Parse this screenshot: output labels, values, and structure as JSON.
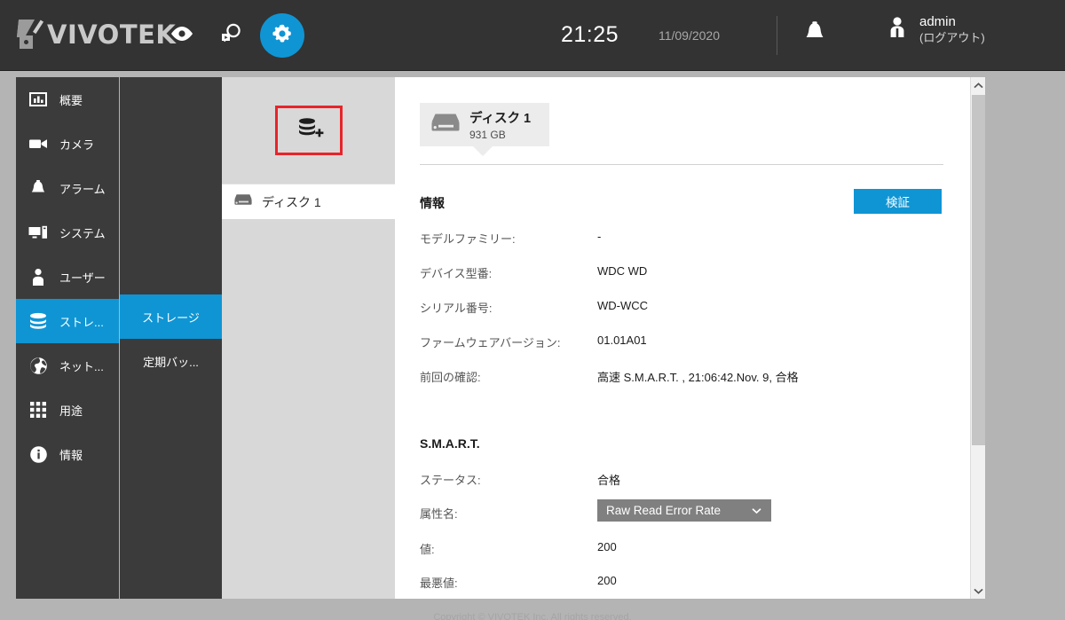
{
  "header": {
    "brand": "VIVOTEK",
    "nav": [
      {
        "name": "live-view",
        "icon": "eye-icon",
        "active": false
      },
      {
        "name": "playback-search",
        "icon": "search-playback-icon",
        "active": false
      },
      {
        "name": "settings",
        "icon": "gear-icon",
        "active": true
      }
    ],
    "time": "21:25",
    "date": "11/09/2020",
    "user": "admin",
    "logout": "(ログアウト)",
    "accent_color": "#0f95d4",
    "bar_color": "#333333"
  },
  "sidebar": {
    "items": [
      {
        "label": "概要",
        "icon": "chart-bars-icon",
        "active": false
      },
      {
        "label": "カメラ",
        "icon": "video-camera-icon",
        "active": false
      },
      {
        "label": "アラーム",
        "icon": "bell-icon",
        "active": false
      },
      {
        "label": "システム",
        "icon": "desktop-tower-icon",
        "active": false
      },
      {
        "label": "ユーザー",
        "icon": "person-icon",
        "active": false
      },
      {
        "label": "ストレ...",
        "icon": "database-icon",
        "active": true
      },
      {
        "label": "ネット...",
        "icon": "globe-icon",
        "active": false
      },
      {
        "label": "用途",
        "icon": "grid-apps-icon",
        "active": false
      },
      {
        "label": "情報",
        "icon": "info-circle-icon",
        "active": false
      }
    ]
  },
  "submenu": {
    "items": [
      {
        "label": "ストレージ",
        "active": true
      },
      {
        "label": "定期バッ...",
        "active": false
      }
    ]
  },
  "disk_column": {
    "add_button_icon": "database-plus-icon",
    "add_button_highlight_color": "#e8242a",
    "list": [
      {
        "label": "ディスク 1",
        "icon": "hard-disk-icon"
      }
    ]
  },
  "main": {
    "disk_tab": {
      "icon": "hard-disk-icon",
      "title": "ディスク 1",
      "size": "931 GB"
    },
    "info_heading": "情報",
    "verify_button": "検証",
    "info_rows": [
      {
        "key": "モデルファミリー:",
        "value": "-"
      },
      {
        "key": "デバイス型番:",
        "value": "WDC WD"
      },
      {
        "key": "シリアル番号:",
        "value": "WD-WCC"
      },
      {
        "key": "ファームウェアバージョン:",
        "value": "01.01A01"
      },
      {
        "key": "前回の確認:",
        "value": "高速 S.M.A.R.T. , 21:06:42.Nov. 9, 合格"
      }
    ],
    "smart_heading": "S.M.A.R.T.",
    "smart_rows": [
      {
        "key": "ステータス:",
        "value": "合格"
      }
    ],
    "attribute_label": "属性名:",
    "attribute_selected": "Raw Read Error Rate",
    "value_rows": [
      {
        "key": "値:",
        "value": "200"
      },
      {
        "key": "最悪値:",
        "value": "200"
      }
    ]
  },
  "footer": {
    "copyright": "Copyright © VIVOTEK Inc. All rights reserved."
  }
}
